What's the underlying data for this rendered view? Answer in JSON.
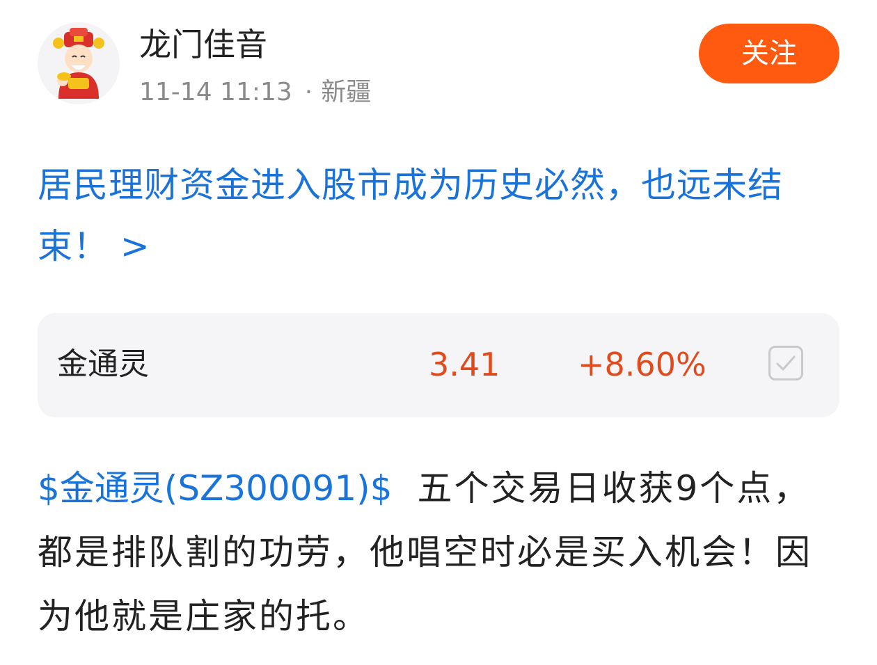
{
  "post": {
    "author": "龙门佳音",
    "timestamp": "11-14 11:13",
    "separator": "·",
    "location": "新疆",
    "follow_label": "关注",
    "avatar_icon": "cartoon-god-of-wealth-avatar",
    "headline": "居民理财资金进入股市成为历史必然，也远未结束！ >"
  },
  "stock_card": {
    "name": "金通灵",
    "price": "3.41",
    "change": "+8.60%",
    "checkbox_icon": "checkmark-icon",
    "price_color": "#e04a1c"
  },
  "content": {
    "stock_tag": "$金通灵(SZ300091)$",
    "text": "五个交易日收获9个点，都是排队割的功劳，他唱空时必是买入机会！因为他就是庄家的托。"
  },
  "colors": {
    "link_blue": "#1a73d8",
    "follow_orange": "#ff5a0f"
  }
}
